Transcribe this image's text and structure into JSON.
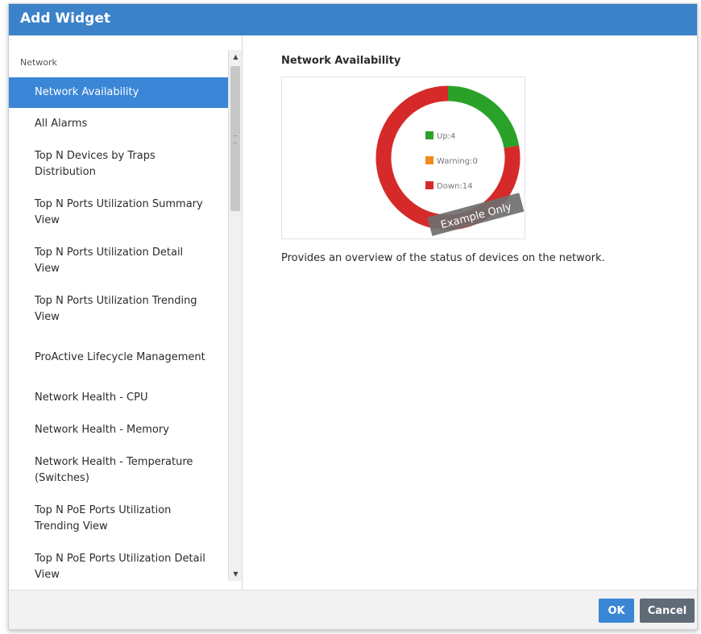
{
  "dialog": {
    "title": "Add Widget"
  },
  "list": {
    "category": "Network",
    "items": [
      "Network Availability",
      "All Alarms",
      "Top N Devices by Traps Distribution",
      "Top N Ports Utilization Summary View",
      "Top N Ports Utilization Detail View",
      "Top N Ports Utilization Trending View",
      "ProActive Lifecycle Management",
      "Network Health - CPU",
      "Network Health - Memory",
      "Network Health - Temperature (Switches)",
      "Top N PoE Ports Utilization Trending View",
      "Top N PoE Ports Utilization Detail View"
    ],
    "selected_index": 0
  },
  "preview": {
    "title": "Network Availability",
    "description": "Provides an overview of the status of devices on the network.",
    "watermark": "Example Only"
  },
  "chart_data": {
    "type": "pie",
    "categories": [
      "Up:4",
      "Warning:0",
      "Down:14"
    ],
    "values": [
      4,
      0,
      14
    ],
    "colors": [
      "#2aa22a",
      "#f08a1c",
      "#d62a2a"
    ],
    "legend_placement": "center"
  },
  "footer": {
    "ok_label": "OK",
    "cancel_label": "Cancel"
  },
  "colors": {
    "titlebar": "#3b82c8",
    "selection": "#3b86d6",
    "ok_button": "#3a86d4",
    "cancel_button": "#5f6b76"
  },
  "icons": {
    "scroll_up": "up-arrow-icon",
    "scroll_down": "down-arrow-icon"
  }
}
